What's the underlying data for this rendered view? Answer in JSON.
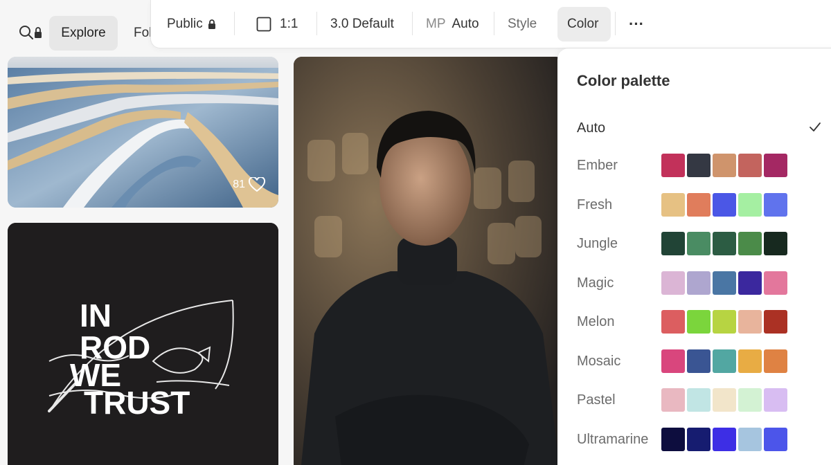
{
  "nav": {
    "explore_label": "Explore",
    "following_label": "Fol"
  },
  "toolbar": {
    "visibility_label": "Public",
    "ratio_label": "1:1",
    "model_label": "3.0 Default",
    "mp_label": "MP",
    "mp_value": "Auto",
    "style_label": "Style",
    "color_label": "Color",
    "more_label": "···"
  },
  "feed": {
    "ice_likes": "81",
    "rod_art": {
      "lines": [
        "IN",
        "ROD",
        "WE",
        "TRUST"
      ]
    }
  },
  "palette": {
    "title": "Color palette",
    "auto_label": "Auto",
    "auto_selected": true,
    "rows": [
      {
        "name": "Ember",
        "colors": [
          "#c2315a",
          "#343843",
          "#cf946c",
          "#c3645e",
          "#a42863"
        ]
      },
      {
        "name": "Fresh",
        "colors": [
          "#e6c183",
          "#e07d5c",
          "#4b57e6",
          "#a5efa2",
          "#6073ed"
        ]
      },
      {
        "name": "Jungle",
        "colors": [
          "#214436",
          "#4a8c63",
          "#2c5c43",
          "#4b8b49",
          "#17291f"
        ]
      },
      {
        "name": "Magic",
        "colors": [
          "#dbb5d5",
          "#aea6cf",
          "#4a76a4",
          "#3b289e",
          "#e3779c"
        ]
      },
      {
        "name": "Melon",
        "colors": [
          "#dc5e60",
          "#7bd53c",
          "#b7d442",
          "#e8b49c",
          "#ab3124"
        ]
      },
      {
        "name": "Mosaic",
        "colors": [
          "#d9467d",
          "#3a5593",
          "#52a7a2",
          "#e8ac44",
          "#df8243"
        ]
      },
      {
        "name": "Pastel",
        "colors": [
          "#e9b8c1",
          "#c1e5e4",
          "#f2e5ca",
          "#d3f2d3",
          "#d8bdf2"
        ]
      },
      {
        "name": "Ultramarine",
        "colors": [
          "#0d0d3e",
          "#161c70",
          "#3d2ee5",
          "#a6c5df",
          "#4c55ea"
        ]
      }
    ]
  }
}
